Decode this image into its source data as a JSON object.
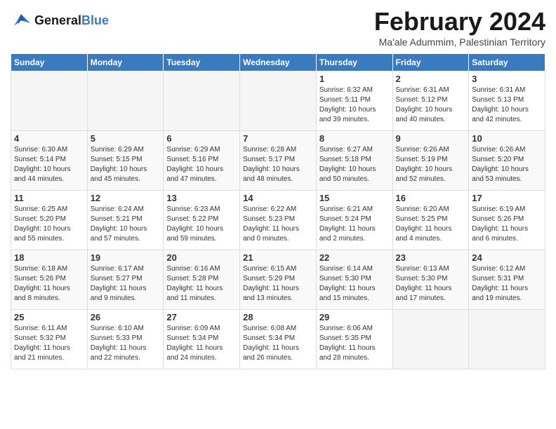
{
  "header": {
    "logo_line1": "General",
    "logo_line2": "Blue",
    "month": "February 2024",
    "location": "Ma'ale Adummim, Palestinian Territory"
  },
  "days_of_week": [
    "Sunday",
    "Monday",
    "Tuesday",
    "Wednesday",
    "Thursday",
    "Friday",
    "Saturday"
  ],
  "weeks": [
    [
      {
        "day": "",
        "info": ""
      },
      {
        "day": "",
        "info": ""
      },
      {
        "day": "",
        "info": ""
      },
      {
        "day": "",
        "info": ""
      },
      {
        "day": "1",
        "info": "Sunrise: 6:32 AM\nSunset: 5:11 PM\nDaylight: 10 hours\nand 39 minutes."
      },
      {
        "day": "2",
        "info": "Sunrise: 6:31 AM\nSunset: 5:12 PM\nDaylight: 10 hours\nand 40 minutes."
      },
      {
        "day": "3",
        "info": "Sunrise: 6:31 AM\nSunset: 5:13 PM\nDaylight: 10 hours\nand 42 minutes."
      }
    ],
    [
      {
        "day": "4",
        "info": "Sunrise: 6:30 AM\nSunset: 5:14 PM\nDaylight: 10 hours\nand 44 minutes."
      },
      {
        "day": "5",
        "info": "Sunrise: 6:29 AM\nSunset: 5:15 PM\nDaylight: 10 hours\nand 45 minutes."
      },
      {
        "day": "6",
        "info": "Sunrise: 6:29 AM\nSunset: 5:16 PM\nDaylight: 10 hours\nand 47 minutes."
      },
      {
        "day": "7",
        "info": "Sunrise: 6:28 AM\nSunset: 5:17 PM\nDaylight: 10 hours\nand 48 minutes."
      },
      {
        "day": "8",
        "info": "Sunrise: 6:27 AM\nSunset: 5:18 PM\nDaylight: 10 hours\nand 50 minutes."
      },
      {
        "day": "9",
        "info": "Sunrise: 6:26 AM\nSunset: 5:19 PM\nDaylight: 10 hours\nand 52 minutes."
      },
      {
        "day": "10",
        "info": "Sunrise: 6:26 AM\nSunset: 5:20 PM\nDaylight: 10 hours\nand 53 minutes."
      }
    ],
    [
      {
        "day": "11",
        "info": "Sunrise: 6:25 AM\nSunset: 5:20 PM\nDaylight: 10 hours\nand 55 minutes."
      },
      {
        "day": "12",
        "info": "Sunrise: 6:24 AM\nSunset: 5:21 PM\nDaylight: 10 hours\nand 57 minutes."
      },
      {
        "day": "13",
        "info": "Sunrise: 6:23 AM\nSunset: 5:22 PM\nDaylight: 10 hours\nand 59 minutes."
      },
      {
        "day": "14",
        "info": "Sunrise: 6:22 AM\nSunset: 5:23 PM\nDaylight: 11 hours\nand 0 minutes."
      },
      {
        "day": "15",
        "info": "Sunrise: 6:21 AM\nSunset: 5:24 PM\nDaylight: 11 hours\nand 2 minutes."
      },
      {
        "day": "16",
        "info": "Sunrise: 6:20 AM\nSunset: 5:25 PM\nDaylight: 11 hours\nand 4 minutes."
      },
      {
        "day": "17",
        "info": "Sunrise: 6:19 AM\nSunset: 5:26 PM\nDaylight: 11 hours\nand 6 minutes."
      }
    ],
    [
      {
        "day": "18",
        "info": "Sunrise: 6:18 AM\nSunset: 5:26 PM\nDaylight: 11 hours\nand 8 minutes."
      },
      {
        "day": "19",
        "info": "Sunrise: 6:17 AM\nSunset: 5:27 PM\nDaylight: 11 hours\nand 9 minutes."
      },
      {
        "day": "20",
        "info": "Sunrise: 6:16 AM\nSunset: 5:28 PM\nDaylight: 11 hours\nand 11 minutes."
      },
      {
        "day": "21",
        "info": "Sunrise: 6:15 AM\nSunset: 5:29 PM\nDaylight: 11 hours\nand 13 minutes."
      },
      {
        "day": "22",
        "info": "Sunrise: 6:14 AM\nSunset: 5:30 PM\nDaylight: 11 hours\nand 15 minutes."
      },
      {
        "day": "23",
        "info": "Sunrise: 6:13 AM\nSunset: 5:30 PM\nDaylight: 11 hours\nand 17 minutes."
      },
      {
        "day": "24",
        "info": "Sunrise: 6:12 AM\nSunset: 5:31 PM\nDaylight: 11 hours\nand 19 minutes."
      }
    ],
    [
      {
        "day": "25",
        "info": "Sunrise: 6:11 AM\nSunset: 5:32 PM\nDaylight: 11 hours\nand 21 minutes."
      },
      {
        "day": "26",
        "info": "Sunrise: 6:10 AM\nSunset: 5:33 PM\nDaylight: 11 hours\nand 22 minutes."
      },
      {
        "day": "27",
        "info": "Sunrise: 6:09 AM\nSunset: 5:34 PM\nDaylight: 11 hours\nand 24 minutes."
      },
      {
        "day": "28",
        "info": "Sunrise: 6:08 AM\nSunset: 5:34 PM\nDaylight: 11 hours\nand 26 minutes."
      },
      {
        "day": "29",
        "info": "Sunrise: 6:06 AM\nSunset: 5:35 PM\nDaylight: 11 hours\nand 28 minutes."
      },
      {
        "day": "",
        "info": ""
      },
      {
        "day": "",
        "info": ""
      }
    ]
  ]
}
